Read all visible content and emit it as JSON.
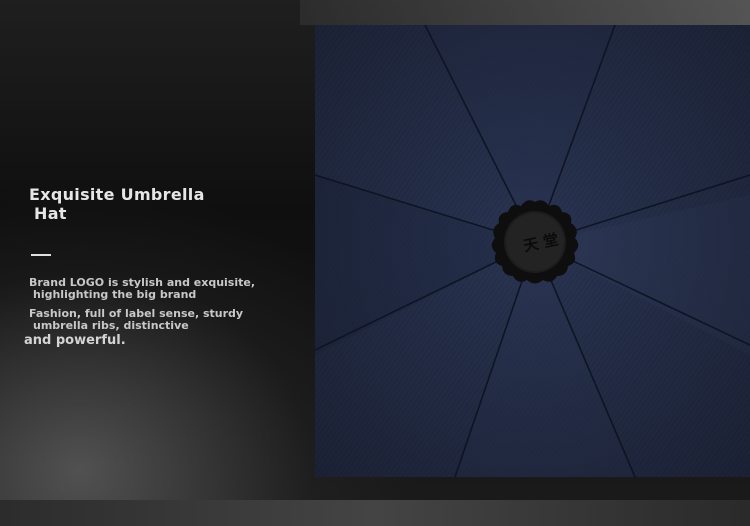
{
  "heading": {
    "line1": "Exquisite Umbrella",
    "line2": "Hat"
  },
  "description": {
    "p1_line1": "Brand LOGO is stylish and exquisite,",
    "p1_line2": "highlighting the big brand",
    "p2_line1": "Fashion, full of label sense, sturdy",
    "p2_line2": "umbrella ribs, distinctive",
    "p3": "and powerful."
  },
  "colors": {
    "fabric": "#26304f",
    "cap": "#151515",
    "background": "#141414"
  },
  "icons": {
    "cap_logo": "umbrella-top-cap-logo-icon"
  }
}
